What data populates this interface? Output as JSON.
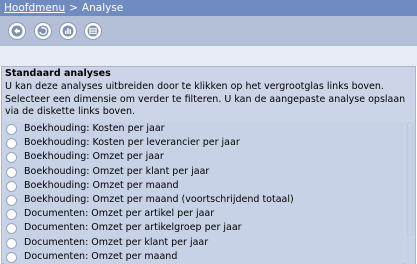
{
  "breadcrumb": {
    "home": "Hoofdmenu",
    "separator": ">",
    "current": "Analyse"
  },
  "toolbar": {
    "buttons": [
      {
        "icon": "back-arrow-icon"
      },
      {
        "icon": "refresh-icon"
      },
      {
        "icon": "bar-chart-icon"
      },
      {
        "icon": "table-icon"
      }
    ]
  },
  "panel": {
    "title": "Standaard analyses",
    "description": "U kan deze analyses uitbreiden door te klikken op het vergrootglas links boven. Selecteer een dimensie om verder te filteren. U kan de aangepaste analyse opslaan via de diskette links boven."
  },
  "analyses": [
    "Boekhouding: Kosten per jaar",
    "Boekhouding: Kosten per leverancier per jaar",
    "Boekhouding: Omzet per jaar",
    "Boekhouding: Omzet per klant per jaar",
    "Boekhouding: Omzet per maand",
    "Boekhouding: Omzet per maand (voortschrijdend totaal)",
    "Documenten: Omzet per artikel per jaar",
    "Documenten: Omzet per artikelgroep per jaar",
    "Documenten: Omzet per klant per jaar",
    "Documenten: Omzet per maand"
  ],
  "colors": {
    "header": "#6f8bbf",
    "toolbar": "#b4c0d8",
    "panel": "#ccd5e7"
  }
}
